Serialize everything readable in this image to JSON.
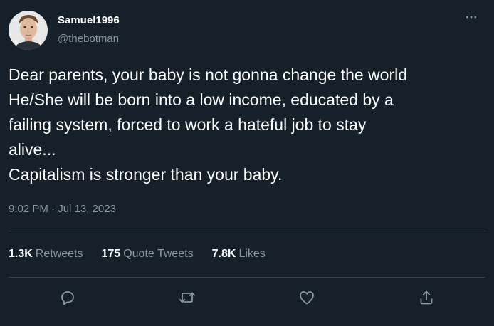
{
  "user": {
    "display_name": "Samuel1996",
    "handle": "@thebotman"
  },
  "tweet": {
    "lines": [
      "Dear parents, your baby is not gonna change the world",
      "He/She will be born into a low income, educated by a",
      "failing system, forced to work a hateful job to stay",
      "alive...",
      "Capitalism is stronger than your baby."
    ],
    "timestamp": "9:02 PM · Jul 13, 2023"
  },
  "stats": {
    "retweets_count": "1.3K",
    "retweets_label": "Retweets",
    "quotes_count": "175",
    "quotes_label": "Quote Tweets",
    "likes_count": "7.8K",
    "likes_label": "Likes"
  },
  "icons": {
    "more": "more-dots-icon",
    "reply": "reply-icon",
    "retweet": "retweet-icon",
    "like": "heart-icon",
    "share": "share-icon"
  },
  "colors": {
    "background": "#15202b",
    "text_primary": "#ffffff",
    "text_secondary": "#8b98a5",
    "divider": "#38444d"
  }
}
